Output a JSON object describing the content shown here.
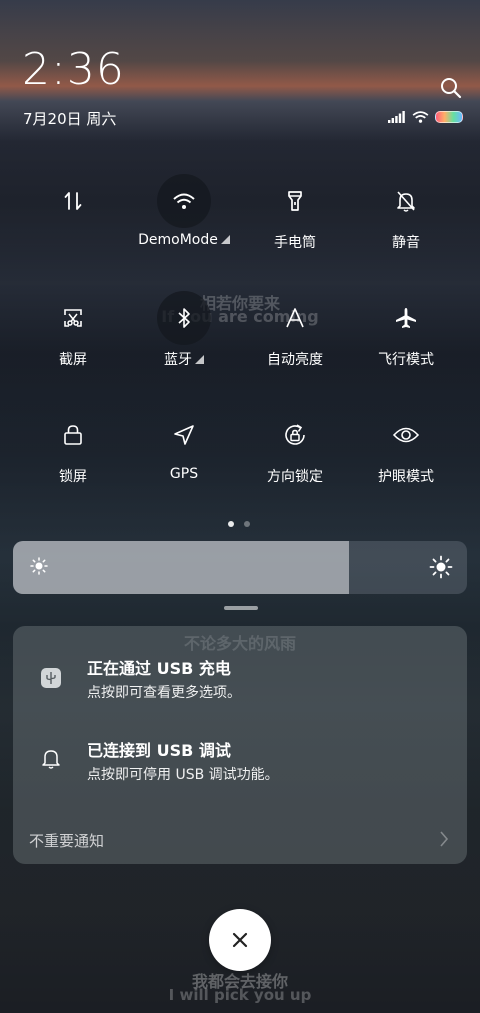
{
  "status": {
    "time": "2:36",
    "date": "7月20日 周六",
    "battery_colors": [
      "#ff5d7a",
      "#ffb067",
      "#66e0a0",
      "#6ab8ff"
    ]
  },
  "background_lyrics": [
    "相若你要来",
    "If you are coming",
    "不论多大的风雨",
    "我都会去接你",
    "I will pick you up"
  ],
  "quick_settings": {
    "row1": [
      {
        "label": "",
        "icon": "data-transfer-icon",
        "active": false
      },
      {
        "label": "DemoMode",
        "icon": "wifi-icon",
        "active": true,
        "expandable": true
      },
      {
        "label": "手电筒",
        "icon": "flashlight-icon",
        "active": false
      },
      {
        "label": "静音",
        "icon": "mute-bell-icon",
        "active": false
      }
    ],
    "row2": [
      {
        "label": "截屏",
        "icon": "screenshot-icon",
        "active": false
      },
      {
        "label": "蓝牙",
        "icon": "bluetooth-icon",
        "active": true,
        "expandable": true
      },
      {
        "label": "自动亮度",
        "icon": "auto-brightness-icon",
        "active": false
      },
      {
        "label": "飞行模式",
        "icon": "airplane-icon",
        "active": false
      }
    ],
    "row3": [
      {
        "label": "锁屏",
        "icon": "lock-icon",
        "active": false
      },
      {
        "label": "GPS",
        "icon": "location-arrow-icon",
        "active": false
      },
      {
        "label": "方向锁定",
        "icon": "rotation-lock-icon",
        "active": false
      },
      {
        "label": "护眼模式",
        "icon": "eye-icon",
        "active": false
      }
    ],
    "page_index": 1,
    "page_count": 2
  },
  "brightness": {
    "level_percent": 74
  },
  "notifications": [
    {
      "title": "正在通过 USB 充电",
      "subtitle": "点按即可查看更多选项。",
      "icon": "usb-icon"
    },
    {
      "title": "已连接到 USB 调试",
      "subtitle": "点按即可停用 USB 调试功能。",
      "icon": "bell-icon"
    }
  ],
  "unimportant_label": "不重要通知",
  "colors": {
    "active_tile_bg": "#14181f",
    "close_button_bg": "#ffffff"
  }
}
